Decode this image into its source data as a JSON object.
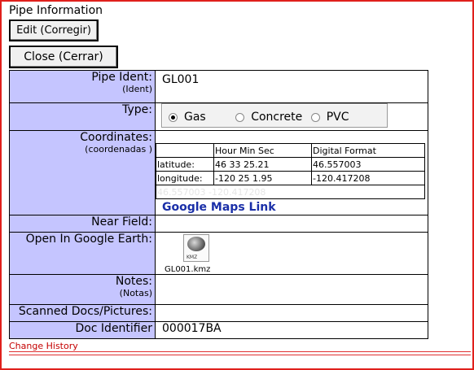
{
  "page": {
    "title": "Pipe Information",
    "edit_button": "Edit (Corregir)",
    "close_button": "Close (Cerrar)",
    "change_history": "Change History"
  },
  "rows": {
    "pipe_ident": {
      "label": "Pipe Ident:",
      "sub": "(Ident)",
      "value": "GL001"
    },
    "type": {
      "label": "Type:",
      "options": [
        "Gas",
        "Concrete",
        "PVC"
      ],
      "selected": "Gas"
    },
    "coordinates": {
      "label": "Coordinates:",
      "sub": "(coordenadas )",
      "headers": [
        "",
        "Hour Min Sec",
        "Digital Format"
      ],
      "latitude": {
        "label": "latitude:",
        "hms": "46 33 25.21",
        "digital": "46.557003"
      },
      "longitude": {
        "label": "longitude:",
        "hms": "-120 25 1.95",
        "digital": "-120.417208"
      },
      "combined": "46.557003 -120.417208",
      "link": "Google Maps Link"
    },
    "near_field": {
      "label": "Near Field:"
    },
    "google_earth": {
      "label": "Open In Google Earth:",
      "file": "GL001.kmz",
      "badge": "KMZ"
    },
    "notes": {
      "label": "Notes:",
      "sub": "(Notas)"
    },
    "scanned": {
      "label": "Scanned Docs/Pictures:"
    },
    "doc_identifier": {
      "label": "Doc Identifier",
      "value": "000017BA"
    }
  },
  "colors": {
    "label_bg": "#c5c5ff",
    "frame_border": "#e0201c",
    "link": "#1a2fa8",
    "history_link": "#c40000"
  }
}
